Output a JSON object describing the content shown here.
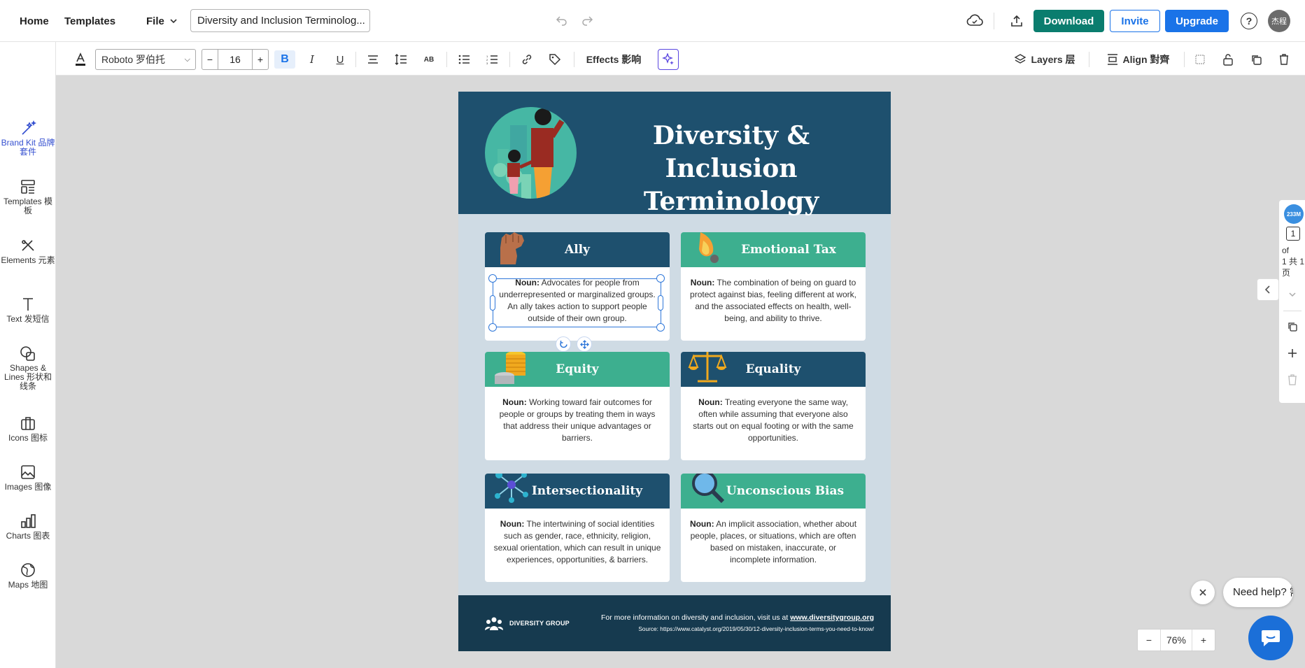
{
  "nav": {
    "home": "Home",
    "templates": "Templates",
    "file": "File",
    "doc_title": "Diversity and Inclusion Terminolog..."
  },
  "actions": {
    "download": "Download",
    "invite": "Invite",
    "upgrade": "Upgrade",
    "help": "?",
    "avatar": "杰程"
  },
  "toolbar": {
    "font": "Roboto 罗伯托",
    "size_minus": "−",
    "size": "16",
    "size_plus": "+",
    "effects": "Effects 影响",
    "layers": "Layers 层",
    "align": "Align 對齊"
  },
  "sidebar": {
    "items": [
      {
        "label": "Brand Kit 品牌套件",
        "icon": "magic-wand-icon"
      },
      {
        "label": "Templates 模板",
        "icon": "templates-icon"
      },
      {
        "label": "Elements 元素",
        "icon": "elements-icon"
      },
      {
        "label": "Text 发短信",
        "icon": "text-icon"
      },
      {
        "label": "Shapes & Lines 形状和线条",
        "icon": "shapes-icon"
      },
      {
        "label": "Icons 图标",
        "icon": "briefcase-icon"
      },
      {
        "label": "Images 图像",
        "icon": "image-icon"
      },
      {
        "label": "Charts 图表",
        "icon": "bar-chart-icon"
      },
      {
        "label": "Maps 地图",
        "icon": "globe-icon"
      }
    ]
  },
  "poster": {
    "title_line1": "Diversity & Inclusion",
    "title_line2": "Terminology",
    "noun": "Noun:",
    "cards": [
      {
        "title": "Ally",
        "text": " Advocates for people from underrepresented or marginalized groups. An ally takes action to support people outside of their own group."
      },
      {
        "title": "Emotional Tax",
        "text": " The combination of being on guard to protect against bias, feeling different at work, and the associated effects on health, well-being, and ability to thrive."
      },
      {
        "title": "Equity",
        "text": " Working toward fair outcomes for people or groups by treating them in ways that address their unique advantages or barriers."
      },
      {
        "title": "Equality",
        "text": " Treating everyone the same way, often while assuming that everyone also starts out on equal footing or with the same opportunities."
      },
      {
        "title": "Intersectionality",
        "text": " The intertwining of social identities such as gender, race, ethnicity, religion, sexual orientation, which can result in unique experiences, opportunities, & barriers."
      },
      {
        "title": "Unconscious Bias",
        "text": " An implicit association, whether about people, places, or situations, which are often based on mistaken, inaccurate, or incomplete information."
      }
    ],
    "footer_brand": "DIVERSITY GROUP",
    "footer_info": "For more information on diversity and inclusion, visit us at ",
    "footer_link": "www.diversitygroup.org",
    "footer_source": "Source: https://www.catalyst.org/2019/05/30/12-diversity-inclusion-terms-you-need-to-know/"
  },
  "rail": {
    "badge": "233M",
    "page_num": "1",
    "of": "of",
    "total": "1 共 1",
    "page_word": "页"
  },
  "zoom": {
    "minus": "−",
    "value": "76%",
    "plus": "+"
  },
  "help": {
    "bubble": "Need help? 需"
  },
  "colors": {
    "navy": "#1e506e",
    "teal": "#3daf8f",
    "download_green": "#0a7d6e",
    "accent_blue": "#1a73e8"
  }
}
